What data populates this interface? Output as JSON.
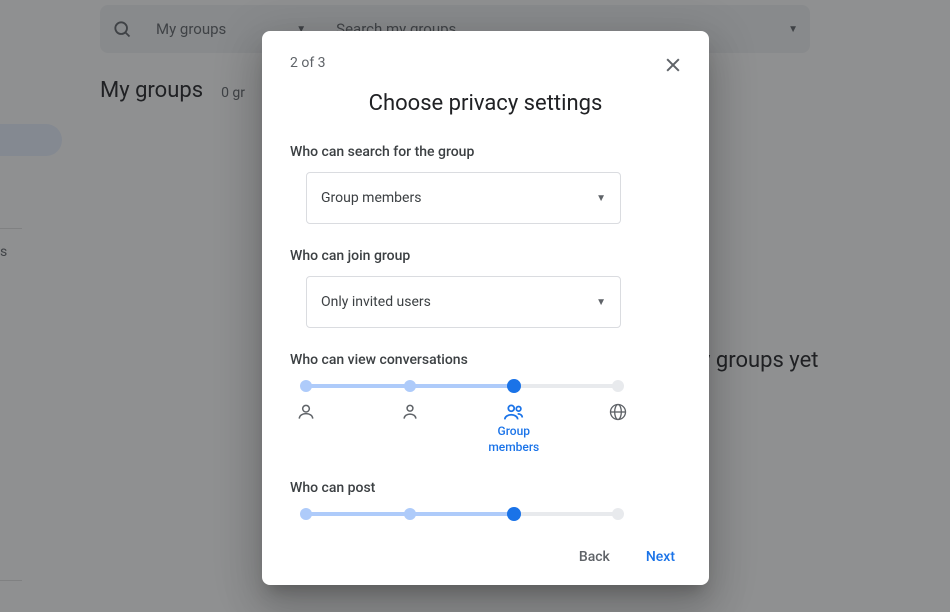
{
  "background": {
    "search": {
      "dropdown_label": "My groups",
      "placeholder": "Search my groups"
    },
    "page_title": "My groups",
    "page_subtitle_prefix": "0 gr",
    "sidebar_frag": "s",
    "empty_state": "y groups yet"
  },
  "dialog": {
    "step_indicator": "2 of 3",
    "title": "Choose privacy settings",
    "sections": {
      "search": {
        "label": "Who can search for the group",
        "value": "Group members"
      },
      "join": {
        "label": "Who can join group",
        "value": "Only invited users"
      },
      "view": {
        "label": "Who can view conversations",
        "selected_label": "Group members"
      },
      "post": {
        "label": "Who can post"
      }
    },
    "footer": {
      "back": "Back",
      "next": "Next"
    }
  }
}
